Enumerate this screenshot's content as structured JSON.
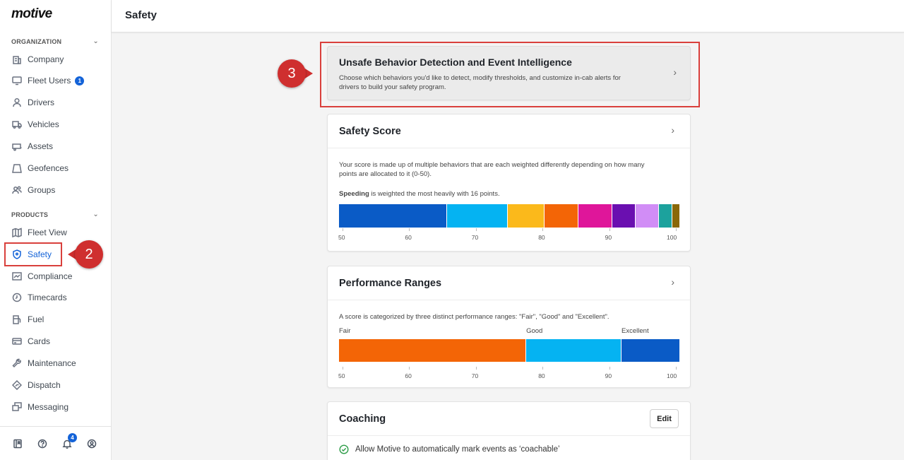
{
  "app": {
    "logo": "motive"
  },
  "header": {
    "title": "Safety"
  },
  "sidebar": {
    "organization_label": "ORGANIZATION",
    "products_label": "PRODUCTS",
    "org_items": [
      {
        "label": "Company",
        "icon": "building-icon"
      },
      {
        "label": "Fleet Users",
        "icon": "monitor-icon",
        "badge": "1"
      },
      {
        "label": "Drivers",
        "icon": "person-icon"
      },
      {
        "label": "Vehicles",
        "icon": "truck-icon"
      },
      {
        "label": "Assets",
        "icon": "trailer-icon"
      },
      {
        "label": "Geofences",
        "icon": "geofence-icon"
      },
      {
        "label": "Groups",
        "icon": "group-icon"
      }
    ],
    "product_items": [
      {
        "label": "Fleet View",
        "icon": "map-icon"
      },
      {
        "label": "Safety",
        "icon": "shield-icon",
        "active": true
      },
      {
        "label": "Compliance",
        "icon": "chart-icon"
      },
      {
        "label": "Timecards",
        "icon": "clock-icon"
      },
      {
        "label": "Fuel",
        "icon": "fuel-icon"
      },
      {
        "label": "Cards",
        "icon": "card-icon"
      },
      {
        "label": "Maintenance",
        "icon": "wrench-icon"
      },
      {
        "label": "Dispatch",
        "icon": "dispatch-icon"
      },
      {
        "label": "Messaging",
        "icon": "message-icon"
      }
    ],
    "notification_count": "4"
  },
  "callouts": {
    "step2": "2",
    "step3": "3"
  },
  "ubd": {
    "title": "Unsafe Behavior Detection and Event Intelligence",
    "desc_line1": "Choose which behaviors you'd like to detect, modify thresholds, and customize in-cab alerts for",
    "desc_line2": "drivers to build your safety program."
  },
  "safety_score": {
    "title": "Safety Score",
    "desc_line1": "Your score is made up of multiple behaviors that are each weighted differently depending on how many",
    "desc_line2": "points are allocated to it (0-50).",
    "highlight_bold": "Speeding",
    "highlight_rest": " is weighted the most heavily with 16 points.",
    "segments": [
      {
        "points": 16,
        "color": "#0a5bc6"
      },
      {
        "points": 9,
        "color": "#05b3f2"
      },
      {
        "points": 5.5,
        "color": "#fbb91b"
      },
      {
        "points": 5,
        "color": "#f36506"
      },
      {
        "points": 5,
        "color": "#df169a"
      },
      {
        "points": 3.5,
        "color": "#6a0fb0"
      },
      {
        "points": 3.5,
        "color": "#d18df6"
      },
      {
        "points": 2,
        "color": "#1ca29d"
      },
      {
        "points": 1,
        "color": "#8a6808"
      }
    ],
    "ticks": [
      "50",
      "60",
      "70",
      "80",
      "90",
      "100"
    ]
  },
  "performance": {
    "title": "Performance Ranges",
    "desc": "A score is categorized by three distinct performance ranges: \"Fair\", \"Good\" and \"Excellent\".",
    "ranges": [
      {
        "label": "Fair",
        "from": 50,
        "to": 77.5,
        "color": "#f36506"
      },
      {
        "label": "Good",
        "from": 77.5,
        "to": 91.5,
        "color": "#05b3f2"
      },
      {
        "label": "Excellent",
        "from": 91.5,
        "to": 100,
        "color": "#0a5bc6"
      }
    ],
    "ticks": [
      "50",
      "60",
      "70",
      "80",
      "90",
      "100"
    ]
  },
  "coaching": {
    "title": "Coaching",
    "edit_label": "Edit",
    "option": "Allow Motive to automatically mark events as ‘coachable’"
  }
}
